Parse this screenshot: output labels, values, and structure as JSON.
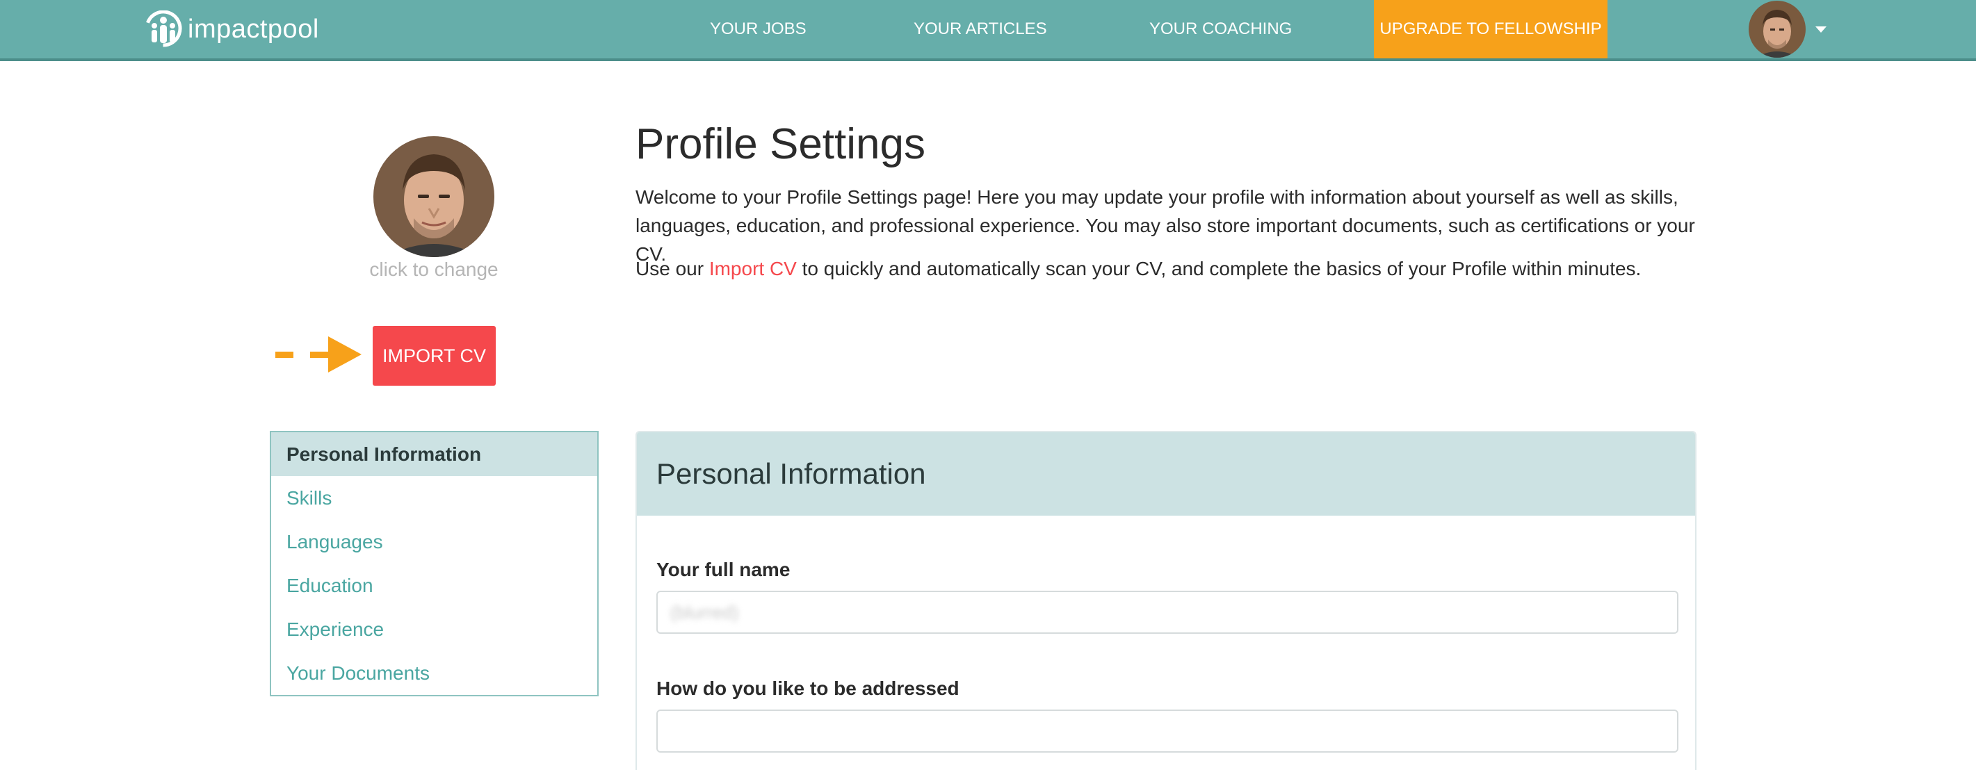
{
  "brand": {
    "name": "impactpool"
  },
  "nav": {
    "jobs": "YOUR JOBS",
    "articles": "YOUR ARTICLES",
    "coaching": "YOUR COACHING",
    "upgrade": "UPGRADE TO FELLOWSHIP"
  },
  "profile": {
    "avatar_caption": "click to change",
    "import_button": "IMPORT CV"
  },
  "side_nav": {
    "items": [
      {
        "label": "Personal Information",
        "active": true
      },
      {
        "label": "Skills"
      },
      {
        "label": "Languages"
      },
      {
        "label": "Education"
      },
      {
        "label": "Experience"
      },
      {
        "label": "Your Documents"
      }
    ]
  },
  "main": {
    "title": "Profile Settings",
    "intro": "Welcome to your Profile Settings page! Here you may update your profile with information about yourself as well as skills, languages, education, and professional experience. You may also store important documents, such as certifications or your CV.",
    "import_prefix": "Use our ",
    "import_link": "Import CV",
    "import_suffix": " to quickly and automatically scan your CV, and complete the basics of your Profile within minutes."
  },
  "panel": {
    "title": "Personal Information",
    "full_name_label": "Your full name",
    "full_name_value": "(blurred)",
    "address_label": "How do you like to be addressed",
    "address_value": ""
  },
  "colors": {
    "header": "#66aeaa",
    "upgrade": "#f7a11a",
    "accent_red": "#f5484c",
    "side_active_bg": "#cce2e3",
    "link_teal": "#4aa6a1"
  },
  "icons": [
    "logo-people-icon",
    "caret-down-icon",
    "arrow-right-icon"
  ]
}
